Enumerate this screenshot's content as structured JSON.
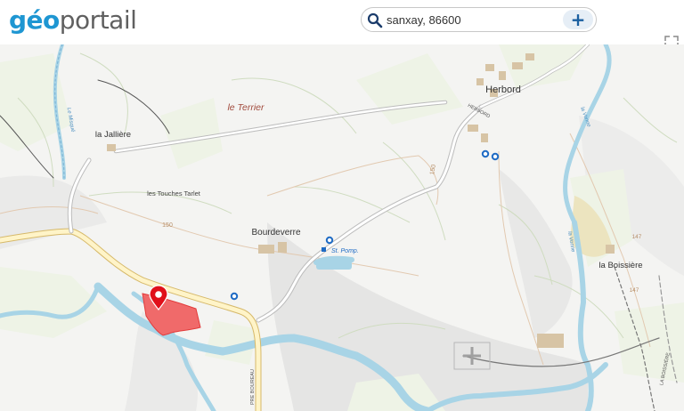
{
  "header": {
    "logo": {
      "part1": "géo",
      "part2": "portail"
    },
    "search": {
      "value": "sanxay, 86600"
    },
    "add_label": "+"
  },
  "map": {
    "places": {
      "herbord": "Herbord",
      "jalliere": "la Jallière",
      "terrier": "le Terrier",
      "touches": "les Touches Tarlet",
      "bourdeverre": "Bourdeverre",
      "boissiere": "la Boissière",
      "stpomp": "St. Pomp."
    },
    "contours": {
      "c1": "150",
      "c2": "150",
      "c3": "147",
      "c4": "147"
    },
    "roads": {
      "herbord_road": "HERBORD",
      "pre_boureau": "PRE BOUREAU",
      "boissiere_road": "LA BOISSIÈRE"
    },
    "rivers": {
      "left": "Le Misqué",
      "right": "la Vonne",
      "right2": "la Vonne"
    },
    "colors": {
      "water": "#a8d4e6",
      "parcel": "#f06a6a",
      "marker": "#e0101a",
      "poi": "#1f6bc4"
    }
  }
}
